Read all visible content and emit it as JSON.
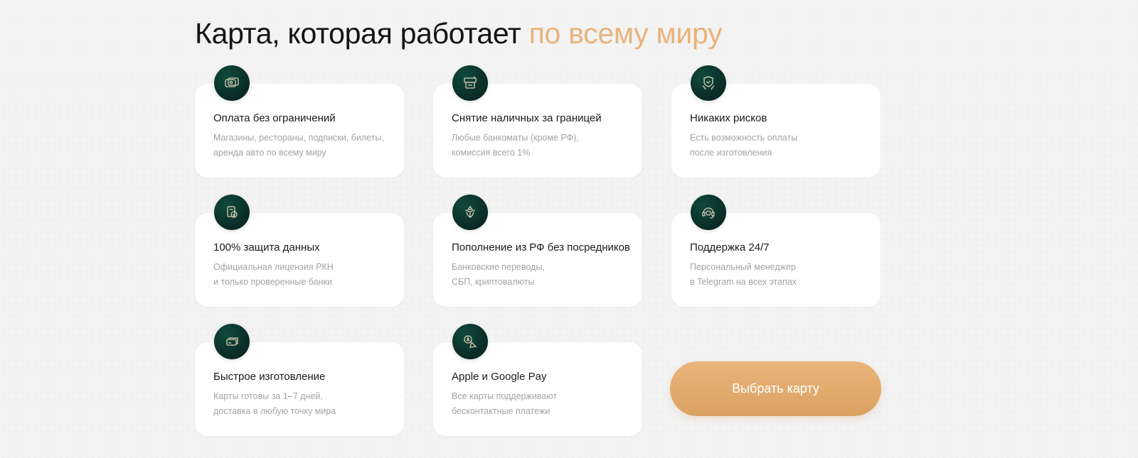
{
  "header": {
    "title_main": "Карта, которая работает ",
    "title_accent": "по всему миру",
    "accent_color": "#e9b37a"
  },
  "features": [
    {
      "icon": "wallet-card-icon",
      "title": "Оплата без ограничений",
      "desc_line1": "Магазины, рестораны, подписки, билеты,",
      "desc_line2": "аренда авто по всему миру"
    },
    {
      "icon": "cash-withdrawal-icon",
      "title": "Снятие наличных за границей",
      "desc_line1": "Любые банкоматы (кроме РФ),",
      "desc_line2": "комиссия всего 1%"
    },
    {
      "icon": "shield-hands-icon",
      "title": "Никаких рисков",
      "desc_line1": "Есть возможность оплаты",
      "desc_line2": "после изготовления"
    },
    {
      "icon": "document-check-icon",
      "title": "100% защита данных",
      "desc_line1": "Официальная лицензия РКН",
      "desc_line2": "и только проверенные банки"
    },
    {
      "icon": "bank-transfer-icon",
      "title": "Пополнение из РФ без посредников",
      "desc_line1": "Банковские переводы,",
      "desc_line2": "СБП, криптовалюты"
    },
    {
      "icon": "support-agent-icon",
      "title": "Поддержка 24/7",
      "desc_line1": "Персональный менеджер",
      "desc_line2": "в Telegram на всех этапах"
    },
    {
      "icon": "cards-stack-icon",
      "title": "Быстрое изготовление",
      "desc_line1": "Карты готовы за 1–7 дней,",
      "desc_line2": "доставка в любую точку мира"
    },
    {
      "icon": "apple-google-pay-icon",
      "title": "Apple и Google Pay",
      "desc_line1": "Все карты поддерживают",
      "desc_line2": "бесконтактные платежи"
    }
  ],
  "cta": {
    "label": "Выбрать карту",
    "color": "#e0aa6c"
  },
  "colors": {
    "icon_bg": "#0b2f28",
    "card_bg": "#ffffff",
    "page_bg": "#f3f3f3"
  }
}
